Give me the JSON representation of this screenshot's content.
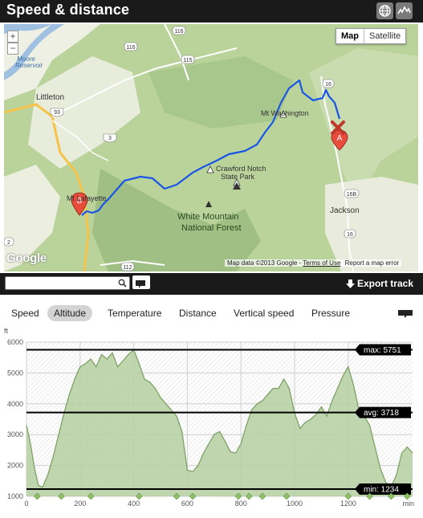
{
  "header": {
    "title": "Speed & distance",
    "globe_icon": "globe-icon",
    "profile_icon": "elevation-profile-icon"
  },
  "map": {
    "zoom_in": "+",
    "zoom_out": "−",
    "type_map": "Map",
    "type_satellite": "Satellite",
    "brand": "Google",
    "attribution": "Map data ©2013 Google",
    "terms": "Terms of Use",
    "report": "Report a map error",
    "labels": {
      "moore": "Moore\nReservoir",
      "littleton": "Littleton",
      "mt_washington": "Mt Washington",
      "crawford_notch": "Crawford Notch\nState Park",
      "white_mountain": "White Mountain\nNational Forest",
      "jackson": "Jackson",
      "mt_lafayette": "Mt Lafayette"
    },
    "shields": [
      "116",
      "116",
      "115",
      "16",
      "93",
      "3",
      "16B",
      "16",
      "112",
      "2"
    ],
    "markers": {
      "a": "A",
      "b": "B"
    }
  },
  "toolbar": {
    "search_value": "",
    "export_label": "Export track"
  },
  "tabs": [
    "Speed",
    "Altitude",
    "Temperature",
    "Distance",
    "Vertical speed",
    "Pressure"
  ],
  "active_tab": "Altitude",
  "chart_data": {
    "type": "area",
    "ylabel": "ft",
    "xlabel": "min",
    "xlim": [
      0,
      1440
    ],
    "ylim": [
      1000,
      6000
    ],
    "x_ticks": [
      0,
      200,
      400,
      600,
      800,
      1000,
      1200
    ],
    "y_ticks": [
      1000,
      2000,
      3000,
      4000,
      5000,
      6000
    ],
    "grid": true,
    "lines": [
      {
        "label": "max: 5751",
        "value": 5751
      },
      {
        "label": "avg: 3718",
        "value": 3718
      },
      {
        "label": "min: 1234",
        "value": 1234
      }
    ],
    "series": [
      {
        "x": [
          0,
          15,
          30,
          45,
          60,
          80,
          100,
          120,
          140,
          160,
          180,
          200,
          220,
          240,
          260,
          280,
          300,
          320,
          340,
          360,
          380,
          400,
          420,
          440,
          460,
          480,
          500,
          520,
          540,
          560,
          580,
          600,
          620,
          640,
          660,
          680,
          700,
          720,
          740,
          760,
          780,
          800,
          820,
          840,
          860,
          880,
          900,
          920,
          940,
          960,
          980,
          1000,
          1020,
          1040,
          1060,
          1080,
          1100,
          1120,
          1140,
          1160,
          1180,
          1200,
          1220,
          1240,
          1260,
          1280,
          1300,
          1320,
          1340,
          1360,
          1380,
          1400,
          1420,
          1440
        ],
        "values": [
          3300,
          2700,
          1900,
          1350,
          1300,
          1700,
          2300,
          3000,
          3700,
          4300,
          4800,
          5200,
          5300,
          5450,
          5200,
          5600,
          5450,
          5650,
          5200,
          5400,
          5600,
          5750,
          5300,
          4800,
          4700,
          4500,
          4200,
          4000,
          3800,
          3600,
          3100,
          1850,
          1800,
          2000,
          2400,
          2700,
          3000,
          3100,
          2800,
          2450,
          2400,
          2700,
          3300,
          3800,
          4000,
          4100,
          4300,
          4500,
          4500,
          4800,
          4500,
          3700,
          3200,
          3400,
          3500,
          3650,
          3900,
          3600,
          4100,
          4500,
          4900,
          5200,
          4600,
          3800,
          3600,
          3300,
          2600,
          1900,
          1450,
          1300,
          1700,
          2400,
          2600,
          2400
        ]
      }
    ],
    "waypoints_x": [
      40,
      130,
      240,
      420,
      560,
      620,
      790,
      830,
      880,
      970,
      1200,
      1280,
      1360,
      1420
    ]
  },
  "colors": {
    "fill": "#b5cfa0",
    "stroke": "#7da266",
    "track": "#1a56e6",
    "marker": "#e74c3c",
    "chrome": "#1a1a1a"
  }
}
